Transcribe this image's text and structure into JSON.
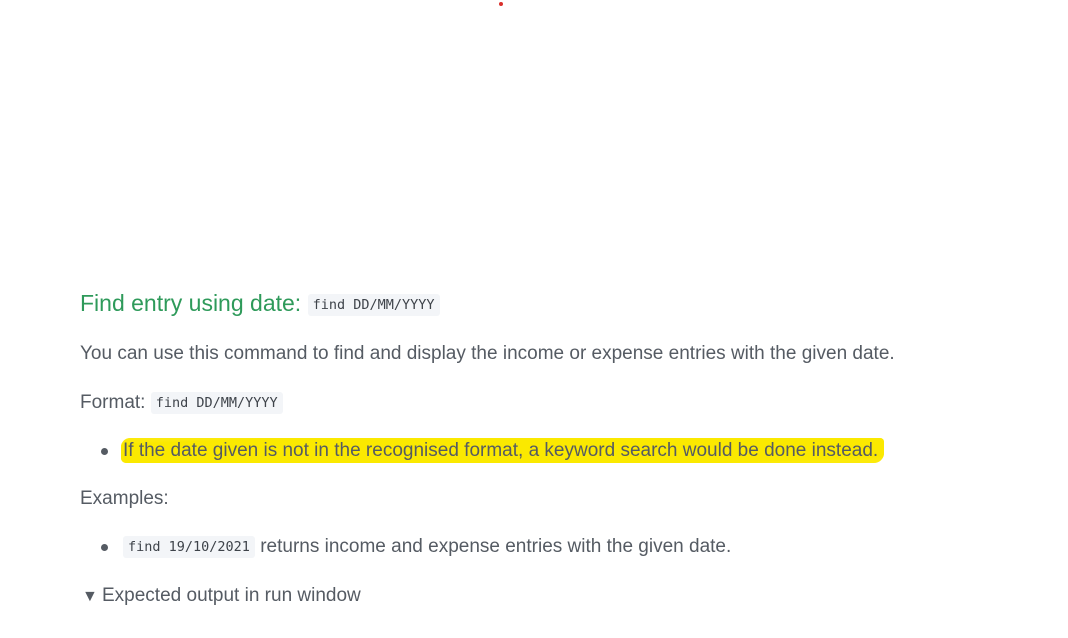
{
  "heading": {
    "text": "Find entry using date:",
    "code": "find DD/MM/YYYY"
  },
  "description": "You can use this command to find and display the income or expense entries with the given date.",
  "format": {
    "label": "Format:",
    "code": "find DD/MM/YYYY"
  },
  "notes": [
    {
      "text": "If the date given is not in the recognised format, a keyword search would be done instead.",
      "highlight_color": "#fbe900"
    }
  ],
  "examples_label": "Examples:",
  "examples": [
    {
      "code": "find 19/10/2021",
      "text": " returns income and expense entries with the given date."
    }
  ],
  "details": {
    "marker": "▼",
    "summary": "Expected output in run window"
  },
  "colors": {
    "heading": "#2e9a5a",
    "body_text": "#555b63",
    "code_background": "#f3f5f8",
    "highlight": "#fbe900",
    "dot": "#d9302c"
  }
}
